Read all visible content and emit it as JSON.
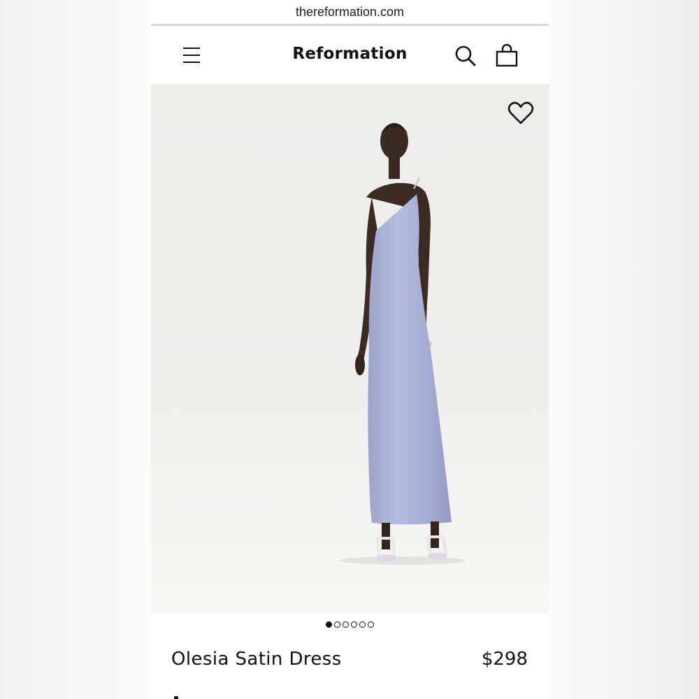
{
  "browser": {
    "url": "thereformation.com"
  },
  "header": {
    "brand": "Reformation",
    "menu_icon": "hamburger-menu-icon",
    "search_icon": "search-icon",
    "bag_icon": "shopping-bag-icon"
  },
  "gallery": {
    "favorite_icon": "heart-outline-icon",
    "total_images": 6,
    "active_index": 0,
    "dress_color": "#a9aed3"
  },
  "product": {
    "name": "Olesia Satin Dress",
    "price": "$298"
  }
}
